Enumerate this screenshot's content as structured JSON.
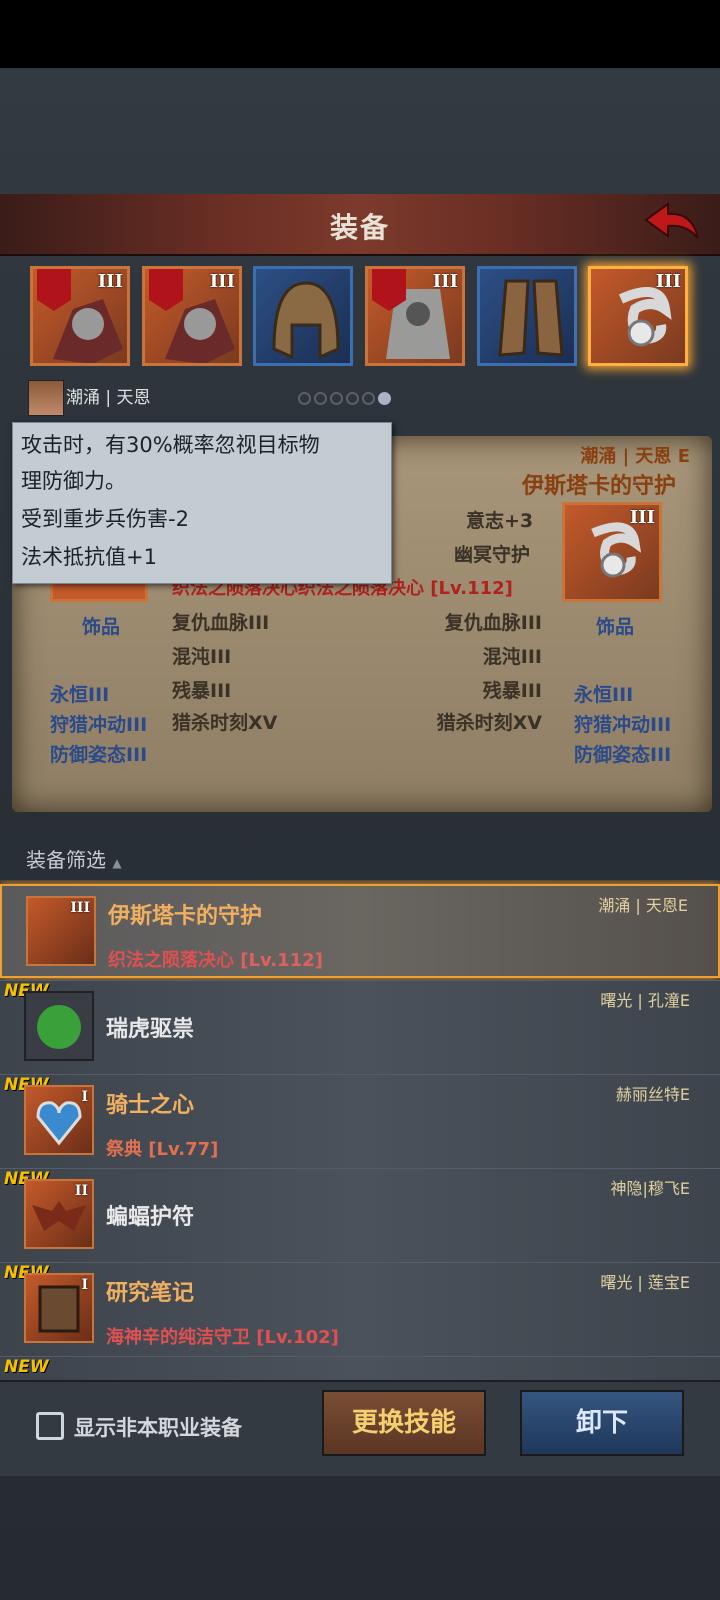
{
  "header": {
    "title": "装备"
  },
  "slots": [
    {
      "tier": "III",
      "color": "orange",
      "banner": true,
      "item": "scarf-icon"
    },
    {
      "tier": "III",
      "color": "orange",
      "banner": true,
      "item": "scarf-icon"
    },
    {
      "tier": "",
      "color": "blue",
      "banner": false,
      "item": "helmet-icon"
    },
    {
      "tier": "III",
      "color": "orange",
      "banner": true,
      "item": "armor-icon"
    },
    {
      "tier": "",
      "color": "blue",
      "banner": false,
      "item": "boots-icon"
    },
    {
      "tier": "III",
      "color": "orange",
      "banner": false,
      "item": "amulet-icon",
      "selected": true
    }
  ],
  "character": {
    "name": "潮涌 | 天恩"
  },
  "pager": {
    "count": 6,
    "active": 5
  },
  "tooltip": {
    "line1": "攻击时，有30%概率忽视目标物",
    "line2": "理防御力。",
    "line3": "受到重步兵伤害-2",
    "line4": "法术抵抗值+1"
  },
  "compare": {
    "owner": "潮涌 | 天恩 E",
    "item_name": "伊斯塔卡的守护",
    "stat1": "意志+3",
    "stat2": "幽冥守护",
    "set_line": "织法之陨落决心织法之陨落决心 [Lv.112]",
    "left_label": "饰品",
    "right_label": "饰品",
    "tier": "III",
    "mid_left": [
      "复仇血脉III",
      "混沌III",
      "残暴III",
      "猎杀时刻XV"
    ],
    "mid_right": [
      "复仇血脉III",
      "混沌III",
      "残暴III",
      "猎杀时刻XV"
    ],
    "side_left": [
      "永恒III",
      "狩猎冲动III",
      "防御姿态III"
    ],
    "side_right": [
      "永恒III",
      "狩猎冲动III",
      "防御姿态III"
    ]
  },
  "filter": {
    "label": "装备筛选"
  },
  "items": [
    {
      "name": "伊斯塔卡的守护",
      "sub": "织法之陨落决心",
      "lv": "[Lv.112]",
      "owner": "潮涌 | 天恩E",
      "tier": "III",
      "new": false,
      "selected": true
    },
    {
      "name": "瑞虎驱祟",
      "sub": "",
      "lv": "",
      "owner": "曙光 | 孔潼E",
      "tier": "",
      "new": true
    },
    {
      "name": "骑士之心",
      "sub": "祭典",
      "lv": "[Lv.77]",
      "owner": "赫丽丝特E",
      "tier": "I",
      "new": true
    },
    {
      "name": "蝙蝠护符",
      "sub": "",
      "lv": "",
      "owner": "神隐|穆飞E",
      "tier": "II",
      "new": true
    },
    {
      "name": "研究笔记",
      "sub": "海神辛的纯洁守卫",
      "lv": "[Lv.102]",
      "owner": "曙光 | 莲宝E",
      "tier": "I",
      "new": true
    }
  ],
  "new_badge": "NEW",
  "footer": {
    "checkbox_label": "显示非本职业装备",
    "swap_button": "更换技能",
    "unequip_button": "卸下"
  }
}
